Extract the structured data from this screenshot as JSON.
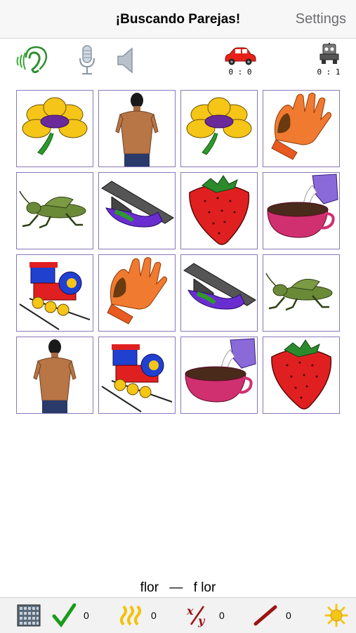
{
  "header": {
    "title": "¡Buscando Parejas!",
    "settings_label": "Settings"
  },
  "toolbar": {
    "icons": [
      "ear-sound-icon",
      "microphone-icon",
      "speaker-icon"
    ],
    "player_score": "0 : 0",
    "robot_score": "0 : 1"
  },
  "grid": {
    "rows": 4,
    "cols": 4,
    "cards": [
      [
        "flower",
        "man-back",
        "flower",
        "glove"
      ],
      [
        "grasshopper",
        "bridge",
        "strawberry",
        "milk-cup"
      ],
      [
        "train",
        "glove",
        "bridge",
        "grasshopper"
      ],
      [
        "man-back",
        "train",
        "milk-cup",
        "strawberry"
      ]
    ]
  },
  "word_pair": {
    "word": "flor",
    "separator": "—",
    "split": "f lor"
  },
  "bottom_bar": {
    "correct_count": "0",
    "sss_count": "0",
    "xy_count": "0",
    "slash_count": "0"
  },
  "colors": {
    "card_border": "#8a78b8",
    "check_green": "#1b9a1b",
    "sss_yellow": "#f2c20a",
    "slash_red": "#9a1515"
  }
}
